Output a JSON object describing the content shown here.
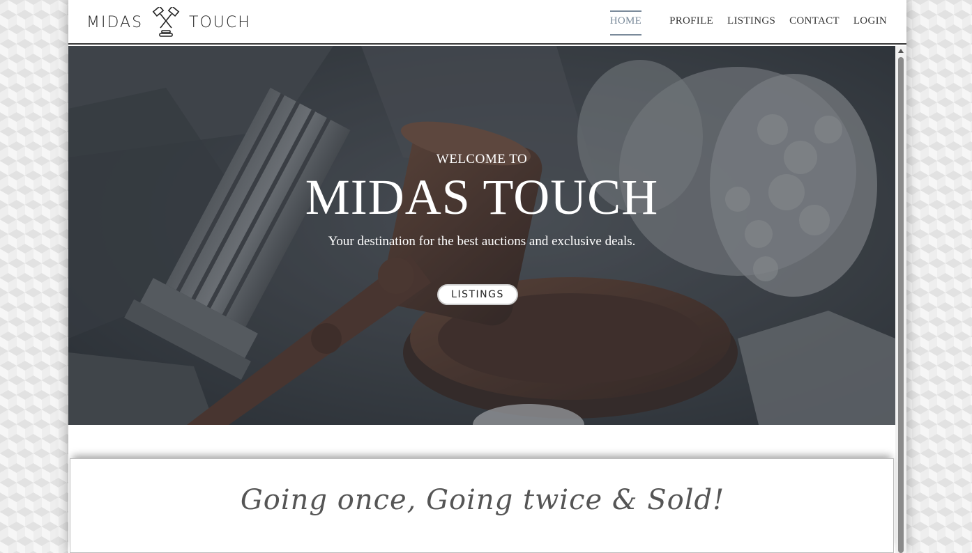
{
  "brand": {
    "logo_left": "MIDAS",
    "logo_right": "TOUCH",
    "logo_icon": "crossed-gavels-icon"
  },
  "nav": {
    "items": [
      {
        "label": "HOME",
        "active": true
      },
      {
        "label": "PROFILE",
        "active": false
      },
      {
        "label": "LISTINGS",
        "active": false
      },
      {
        "label": "CONTACT",
        "active": false
      },
      {
        "label": "LOGIN",
        "active": false
      }
    ]
  },
  "hero": {
    "welcome": "WELCOME TO",
    "title": "MIDAS TOUCH",
    "tagline": "Your destination for the best auctions and exclusive deals.",
    "button_label": "LISTINGS"
  },
  "slogan": "Going once, Going twice & Sold!",
  "colors": {
    "active_nav": "#7a8a9a",
    "hero_overlay": "#3f454c",
    "text_dark": "#222222"
  }
}
